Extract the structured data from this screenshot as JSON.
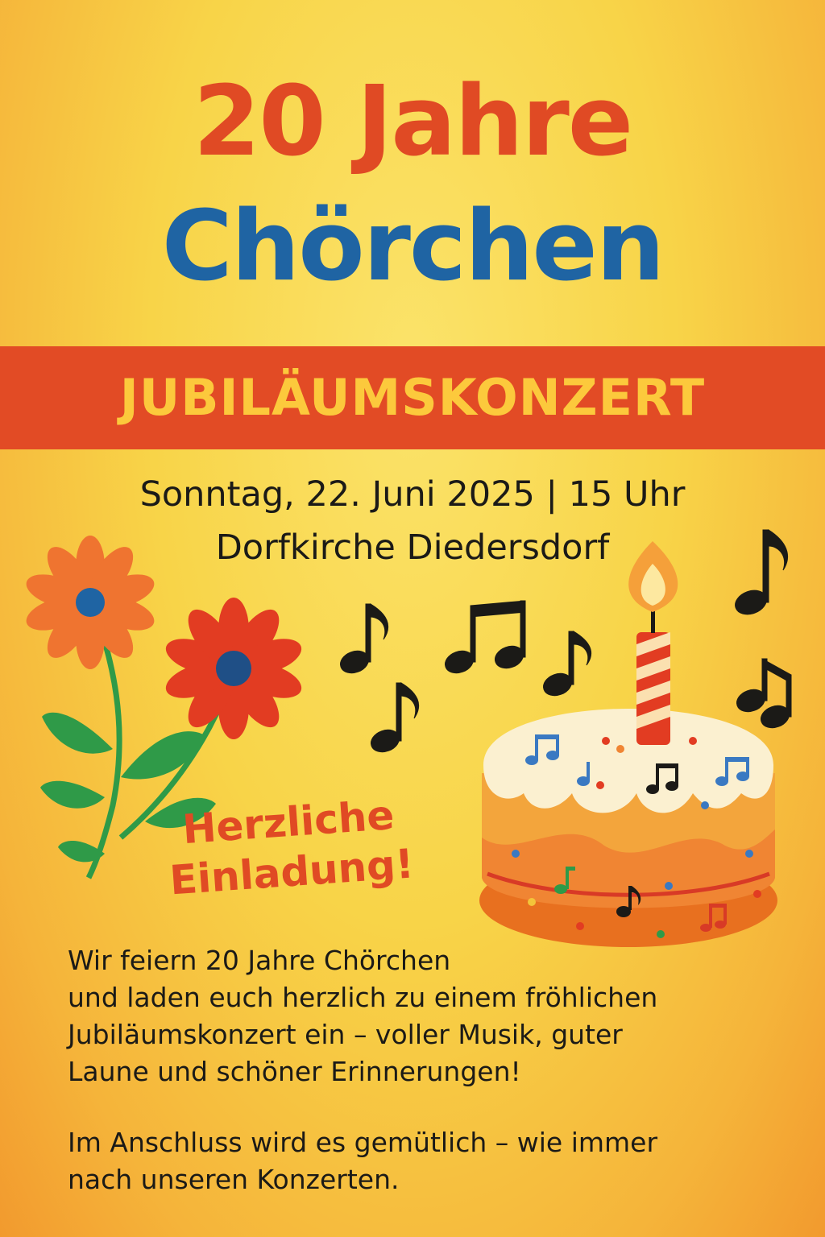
{
  "poster": {
    "title_line1": "20 Jahre",
    "title_line2": "Chörchen",
    "banner": "JUBILÄUMSKONZERT",
    "date_time": "Sonntag, 22. Juni 2025 | 15 Uhr",
    "venue": "Dorfkirche Diedersdorf",
    "invitation_line1": "Herzliche",
    "invitation_line2": "Einladung!",
    "paragraph1": [
      "Wir feiern 20 Jahre Chörchen",
      "und laden euch herzlich zu einem fröhlichen",
      "Jubiläumskonzert ein – voller Musik, guter",
      "Laune und schöner Erinnerungen!"
    ],
    "paragraph2": [
      "Im Anschluss wird es gemütlich – wie immer",
      "nach unseren Konzerten."
    ]
  },
  "colors": {
    "background": "#f8d448",
    "title_red": "#e04a24",
    "title_blue": "#1f64a3",
    "banner_red": "#e24b25",
    "banner_text_yellow": "#fcc93c",
    "text_dark": "#1b1a17"
  },
  "icons": [
    "flower-icon",
    "music-note-icon",
    "birthday-cake-icon",
    "candle-icon"
  ]
}
